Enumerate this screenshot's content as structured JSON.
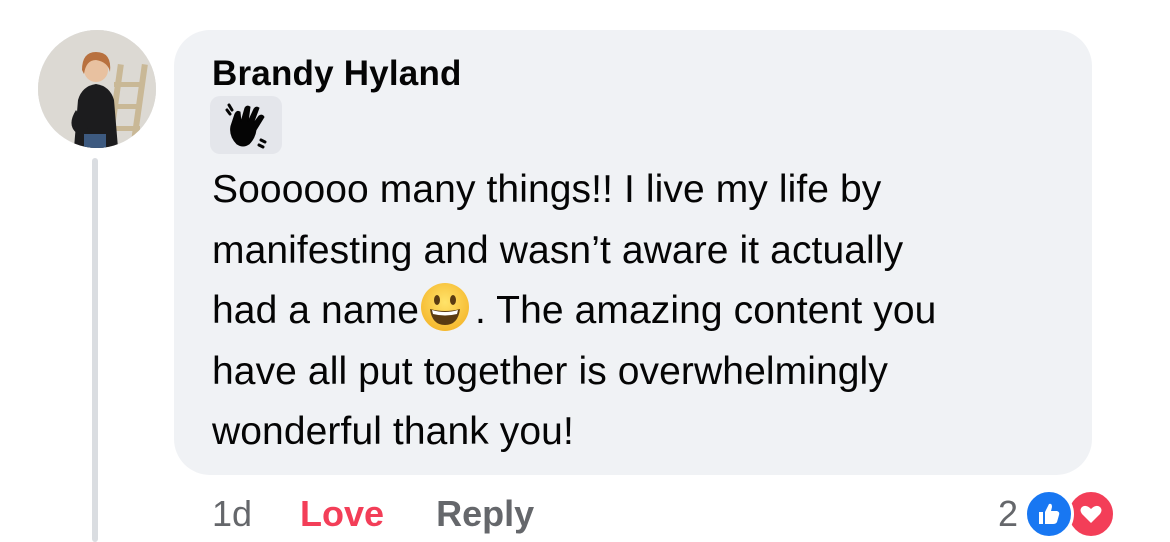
{
  "comment": {
    "author": "Brandy Hyland",
    "badge_icon": "waving-hand-icon",
    "text_lines": [
      "Soooooo many things!! I live my life by",
      "manifesting and wasn’t aware it actually",
      "had a name",
      ". The amazing content you",
      "have all put together is overwhelmingly",
      "wonderful thank you!"
    ],
    "inline_emoji": "grinning-face-emoji"
  },
  "actions": {
    "timestamp": "1d",
    "love_label": "Love",
    "reply_label": "Reply"
  },
  "reactions": {
    "count": "2",
    "icons": [
      "like-icon",
      "love-icon"
    ]
  },
  "colors": {
    "bubble_bg": "#f0f2f5",
    "love": "#f33e58",
    "like": "#1877f2",
    "muted": "#65676b"
  }
}
